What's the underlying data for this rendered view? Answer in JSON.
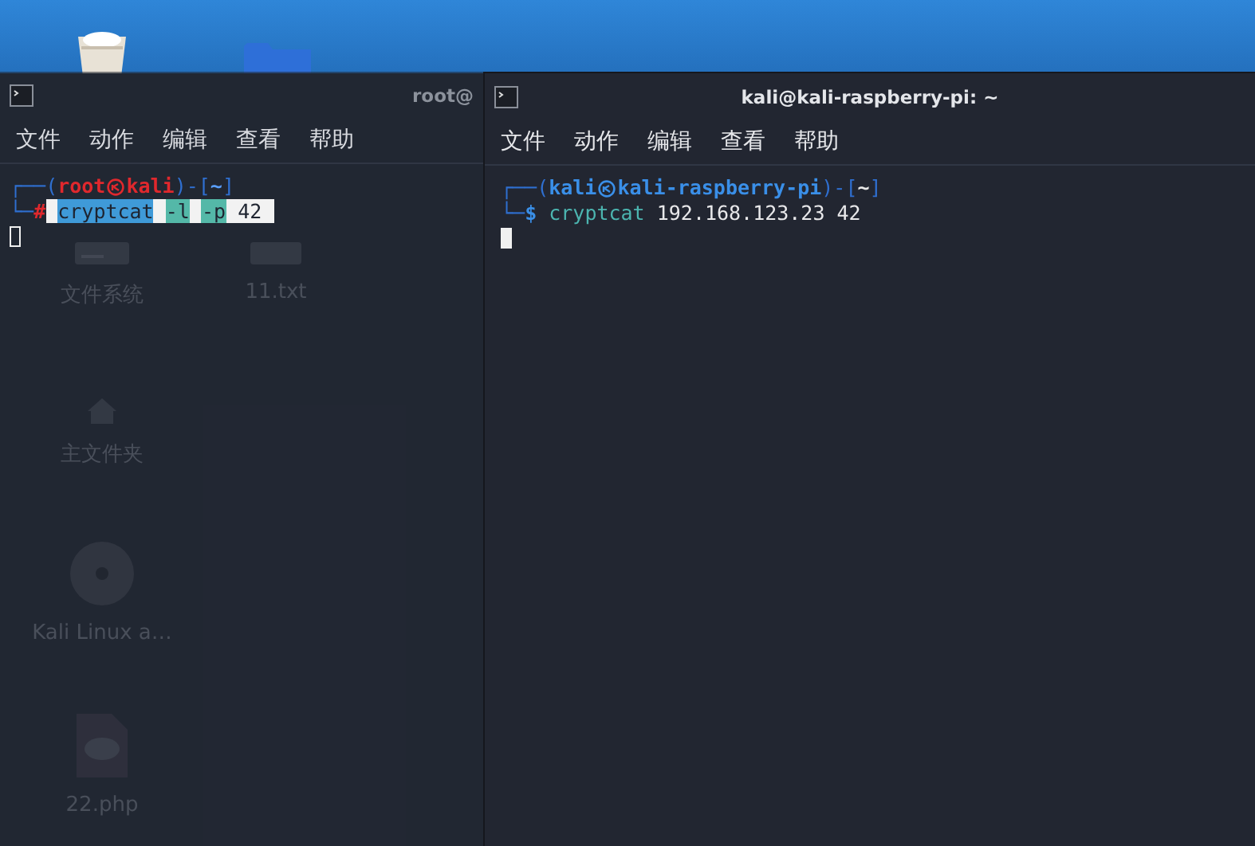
{
  "desktop": {
    "icons": [
      {
        "kind": "filesystem",
        "label": "文件系统"
      },
      {
        "kind": "textfile",
        "label": "11.txt"
      },
      {
        "kind": "home",
        "label": "主文件夹"
      },
      {
        "kind": "disc",
        "label": "Kali Linux a…"
      },
      {
        "kind": "php",
        "label": "22.php"
      }
    ]
  },
  "windows": [
    {
      "title": "root@",
      "focused": false,
      "menu": [
        "文件",
        "动作",
        "编辑",
        "查看",
        "帮助"
      ],
      "prompt": {
        "kind": "root",
        "open": "┌──(",
        "user": "root",
        "host": "kali",
        "mid": ")-[",
        "dir": "~",
        "close": "]",
        "corner": "└─",
        "symbol": "#"
      },
      "command": [
        {
          "text": "cryptcat",
          "kind": "command",
          "highlighted": true
        },
        {
          "text": "-l",
          "kind": "option",
          "highlighted": true
        },
        {
          "text": "-p",
          "kind": "option",
          "highlighted": true
        },
        {
          "text": "42",
          "kind": "argument",
          "highlighted": true
        }
      ]
    },
    {
      "title": "kali@kali-raspberry-pi: ~",
      "focused": true,
      "menu": [
        "文件",
        "动作",
        "编辑",
        "查看",
        "帮助"
      ],
      "prompt": {
        "kind": "user",
        "open": "┌──(",
        "user": "kali",
        "host": "kali-raspberry-pi",
        "mid": ")-[",
        "dir": "~",
        "close": "]",
        "corner": "└─",
        "symbol": "$"
      },
      "command": [
        {
          "text": "cryptcat",
          "kind": "command",
          "highlighted": false
        },
        {
          "text": "192.168.123.23",
          "kind": "argument",
          "highlighted": false
        },
        {
          "text": "42",
          "kind": "argument",
          "highlighted": false
        }
      ]
    }
  ]
}
